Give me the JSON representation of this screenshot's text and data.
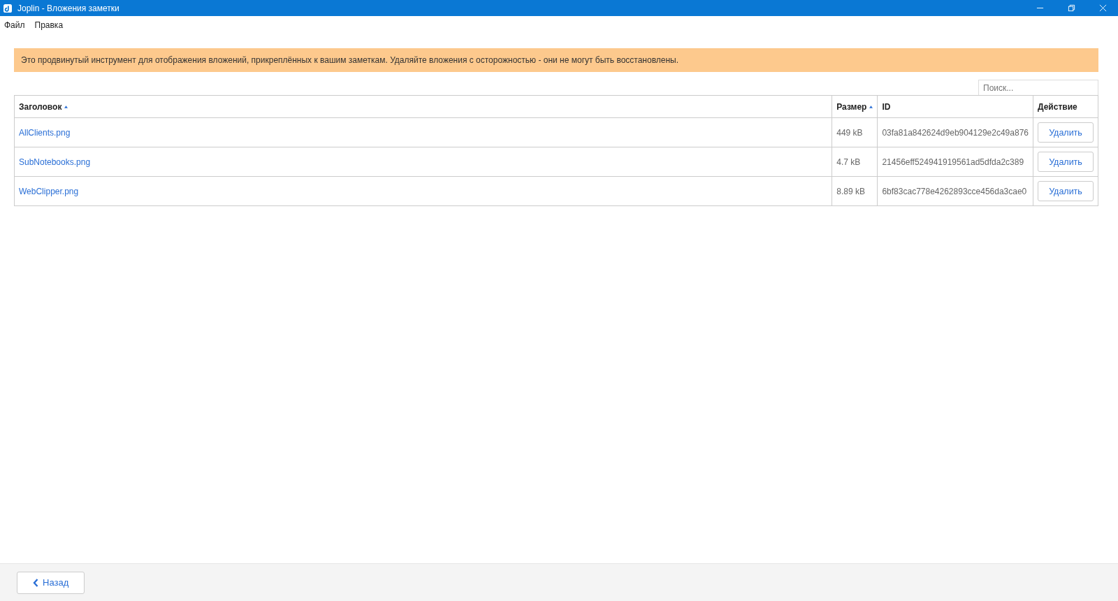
{
  "window": {
    "title": "Joplin - Вложения заметки"
  },
  "menu": [
    "Файл",
    "Правка"
  ],
  "banner": "Это продвинутый инструмент для отображения вложений, прикреплённых к вашим заметкам. Удаляйте вложения с осторожностью - они не могут быть восстановлены.",
  "search": {
    "placeholder": "Поиск..."
  },
  "table": {
    "columns": [
      {
        "label": "Заголовок",
        "sorted": true
      },
      {
        "label": "Размер",
        "sorted": true
      },
      {
        "label": "ID",
        "sorted": false
      },
      {
        "label": "Действие",
        "sorted": false
      }
    ],
    "rows": [
      {
        "title": "AllClients.png",
        "size": "449 kB",
        "id": "03fa81a842624d9eb904129e2c49a876",
        "action": "Удалить"
      },
      {
        "title": "SubNotebooks.png",
        "size": "4.7 kB",
        "id": "21456eff524941919561ad5dfda2c389",
        "action": "Удалить"
      },
      {
        "title": "WebClipper.png",
        "size": "8.89 kB",
        "id": "6bf83cac778e4262893cce456da3cae0",
        "action": "Удалить"
      }
    ]
  },
  "footer": {
    "back_button": "Назад"
  }
}
